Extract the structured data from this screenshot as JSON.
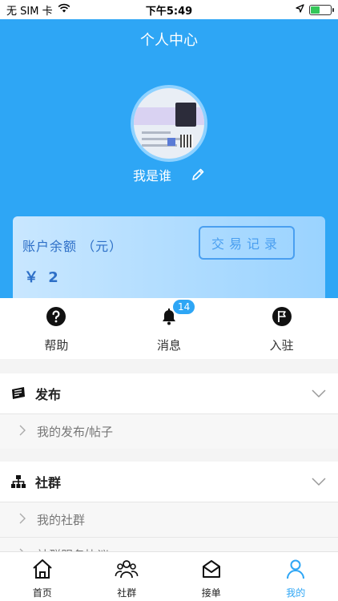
{
  "status_bar": {
    "carrier": "无 SIM 卡",
    "time": "下午5:49"
  },
  "header": {
    "title": "个人中心",
    "user_name": "我是谁"
  },
  "balance": {
    "label": "账户余额 （元）",
    "value": "￥ 2",
    "transactions_label": "交易记录"
  },
  "quick_actions": [
    {
      "label": "帮助",
      "icon": "help-icon"
    },
    {
      "label": "消息",
      "icon": "bell-icon",
      "badge": "14"
    },
    {
      "label": "入驻",
      "icon": "flag-icon"
    }
  ],
  "sections": [
    {
      "title": "发布",
      "icon": "publish-icon",
      "items": [
        "我的发布/帖子"
      ]
    },
    {
      "title": "社群",
      "icon": "org-chart-icon",
      "items": [
        "我的社群",
        "社群服务协议"
      ]
    }
  ],
  "tabbar": [
    {
      "label": "首页",
      "icon": "home-icon",
      "active": false
    },
    {
      "label": "社群",
      "icon": "group-icon",
      "active": false
    },
    {
      "label": "接单",
      "icon": "inbox-icon",
      "active": false
    },
    {
      "label": "我的",
      "icon": "person-icon",
      "active": true
    }
  ],
  "colors": {
    "brand": "#2ea6f5",
    "balance_text": "#2d6fc7"
  }
}
